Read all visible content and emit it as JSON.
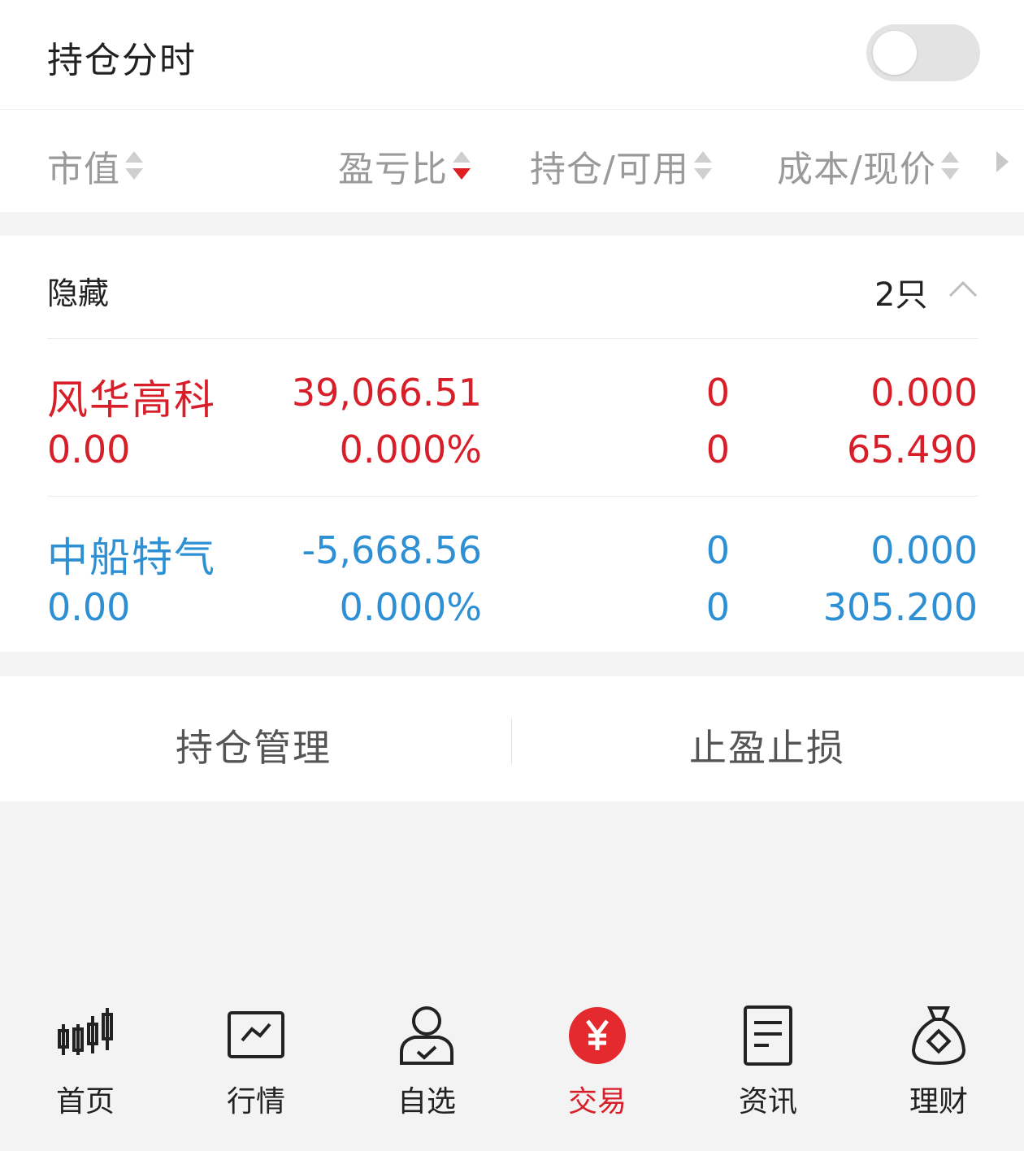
{
  "header": {
    "title": "持仓分时",
    "toggle_on": false
  },
  "columns": [
    {
      "label": "市值",
      "sort": "none"
    },
    {
      "label": "盈亏比",
      "sort": "desc"
    },
    {
      "label": "持仓/可用",
      "sort": "none"
    },
    {
      "label": "成本/现价",
      "sort": "none"
    }
  ],
  "group": {
    "label": "隐藏",
    "count": "2只",
    "expanded": true
  },
  "holdings": [
    {
      "name": "风华高科",
      "market_value": "39,066.51",
      "profit_loss": "0.00",
      "ratio": "0.000%",
      "position": "0",
      "available": "0",
      "cost": "0.000",
      "price": "65.490",
      "color": "#d81e28"
    },
    {
      "name": "中船特气",
      "market_value": "-5,668.56",
      "profit_loss": "0.00",
      "ratio": "0.000%",
      "position": "0",
      "available": "0",
      "cost": "0.000",
      "price": "305.200",
      "color": "#2d8fd4"
    }
  ],
  "actions": {
    "manage": "持仓管理",
    "stop": "止盈止损"
  },
  "nav": [
    {
      "label": "首页",
      "icon": "candlestick-icon"
    },
    {
      "label": "行情",
      "icon": "chart-icon"
    },
    {
      "label": "自选",
      "icon": "user-check-icon"
    },
    {
      "label": "交易",
      "icon": "yuan-icon",
      "active": true
    },
    {
      "label": "资讯",
      "icon": "document-icon"
    },
    {
      "label": "理财",
      "icon": "money-bag-icon"
    }
  ],
  "colors": {
    "accent": "#d81e28",
    "up": "#d81e28",
    "down": "#2d8fd4"
  }
}
